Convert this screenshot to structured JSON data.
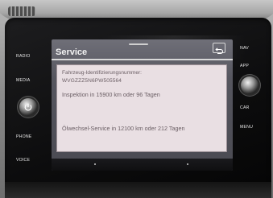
{
  "bezel": {
    "left_buttons": [
      "RADIO",
      "MEDIA",
      "PHONE",
      "VOICE"
    ],
    "right_buttons": [
      "NAV",
      "APP",
      "CAR",
      "MENU"
    ]
  },
  "screen": {
    "title": "Service",
    "info": {
      "vin_label": "Fahrzeug-Identifizierungsnummer:",
      "vin_value": "WVGZZZ5N6PW505564",
      "inspection": "Inspektion in 15900 km oder 96 Tagen",
      "oil_service": "Ölwechsel-Service in 12100 km oder 212 Tagen"
    }
  },
  "icons": [
    "back-icon",
    "power-icon"
  ],
  "colors": {
    "screen_bg": "#5a5a62",
    "panel_bg": "#e9dfe3",
    "panel_text": "#6b5f65",
    "bezel": "#111111"
  }
}
